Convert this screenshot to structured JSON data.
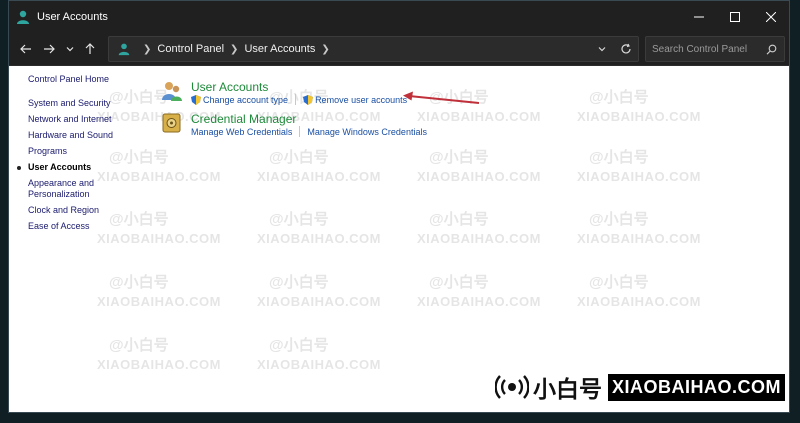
{
  "window": {
    "title": "User Accounts"
  },
  "address": {
    "crumbs": [
      "Control Panel",
      "User Accounts"
    ]
  },
  "search": {
    "placeholder": "Search Control Panel"
  },
  "sidebar": {
    "home": "Control Panel Home",
    "items": [
      {
        "label": "System and Security"
      },
      {
        "label": "Network and Internet"
      },
      {
        "label": "Hardware and Sound"
      },
      {
        "label": "Programs"
      },
      {
        "label": "User Accounts",
        "active": true
      },
      {
        "label": "Appearance and Personalization"
      },
      {
        "label": "Clock and Region"
      },
      {
        "label": "Ease of Access"
      }
    ]
  },
  "panels": [
    {
      "title": "User Accounts",
      "icon": "users-icon",
      "links": [
        {
          "label": "Change account type",
          "icon": "shield-icon"
        },
        {
          "label": "Remove user accounts",
          "icon": "shield-icon"
        }
      ]
    },
    {
      "title": "Credential Manager",
      "icon": "vault-icon",
      "links": [
        {
          "label": "Manage Web Credentials"
        },
        {
          "label": "Manage Windows Credentials"
        }
      ]
    }
  ],
  "watermark": {
    "cn": "@小白号",
    "en": "XIAOBAIHAO.COM"
  },
  "colors": {
    "accent_title": "#1e8a3a",
    "link": "#1a4fa3",
    "arrow": "#c0303a"
  }
}
